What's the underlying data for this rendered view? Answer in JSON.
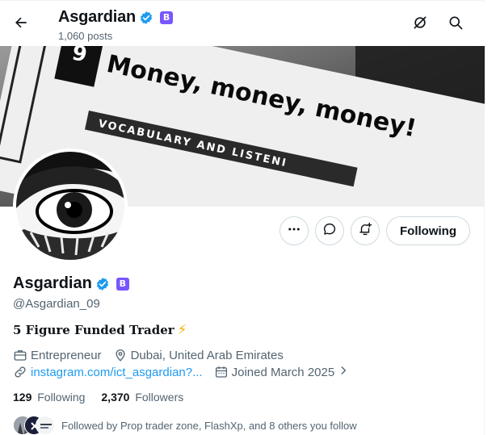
{
  "header": {
    "name": "Asgardian",
    "posts": "1,060 posts",
    "badge_letter": "B",
    "back_icon": "arrow-left-icon",
    "grok_icon": "grok-icon",
    "search_icon": "search-icon"
  },
  "banner": {
    "number": "9",
    "headline": "Money, money, money!",
    "subline": "VOCABULARY AND LISTENI"
  },
  "actions": {
    "more_icon": "more-icon",
    "message_icon": "message-icon",
    "notify_icon": "notification-add-icon",
    "following_label": "Following"
  },
  "profile": {
    "name": "Asgardian",
    "badge_letter": "B",
    "handle": "@Asgardian_09",
    "bio": "5 Figure Funded Trader",
    "bio_emoji": "⚡",
    "category": "Entrepreneur",
    "location": "Dubai, United Arab Emirates",
    "website": "instagram.com/ict_asgardian?...",
    "joined": "Joined March 2025",
    "following_count": "129",
    "following_label": "Following",
    "followers_count": "2,370",
    "followers_label": "Followers",
    "followed_by": "Followed by Prop trader zone, FlashXp, and 8 others you follow"
  },
  "colors": {
    "accent": "#1d9bf0",
    "verified": "#1d9bf0",
    "badge": "#7856ff",
    "muted_text": "#536471",
    "border": "#cfd9de"
  }
}
